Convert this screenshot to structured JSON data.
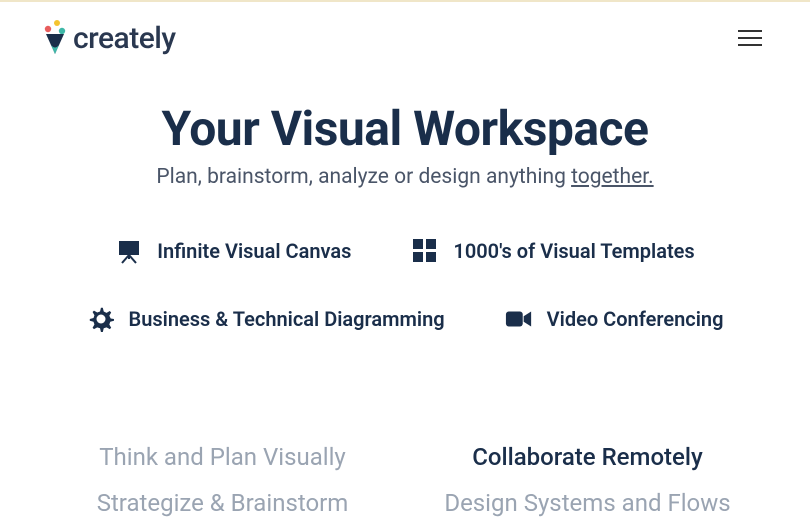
{
  "brand": {
    "name": "creately"
  },
  "hero": {
    "title": "Your Visual Workspace",
    "subtitle_prefix": "Plan, brainstorm, analyze or design anything ",
    "subtitle_underline": "together."
  },
  "features": [
    {
      "icon": "easel-icon",
      "label": "Infinite Visual Canvas"
    },
    {
      "icon": "grid-icon",
      "label": "1000's of Visual Templates"
    },
    {
      "icon": "gear-icon",
      "label": "Business & Technical Diagramming"
    },
    {
      "icon": "video-icon",
      "label": "Video Conferencing"
    }
  ],
  "tabs": [
    {
      "label": "Think and Plan Visually",
      "active": false
    },
    {
      "label": "Collaborate Remotely",
      "active": true
    },
    {
      "label": "Strategize & Brainstorm",
      "active": false
    },
    {
      "label": "Design Systems and Flows",
      "active": false
    }
  ]
}
